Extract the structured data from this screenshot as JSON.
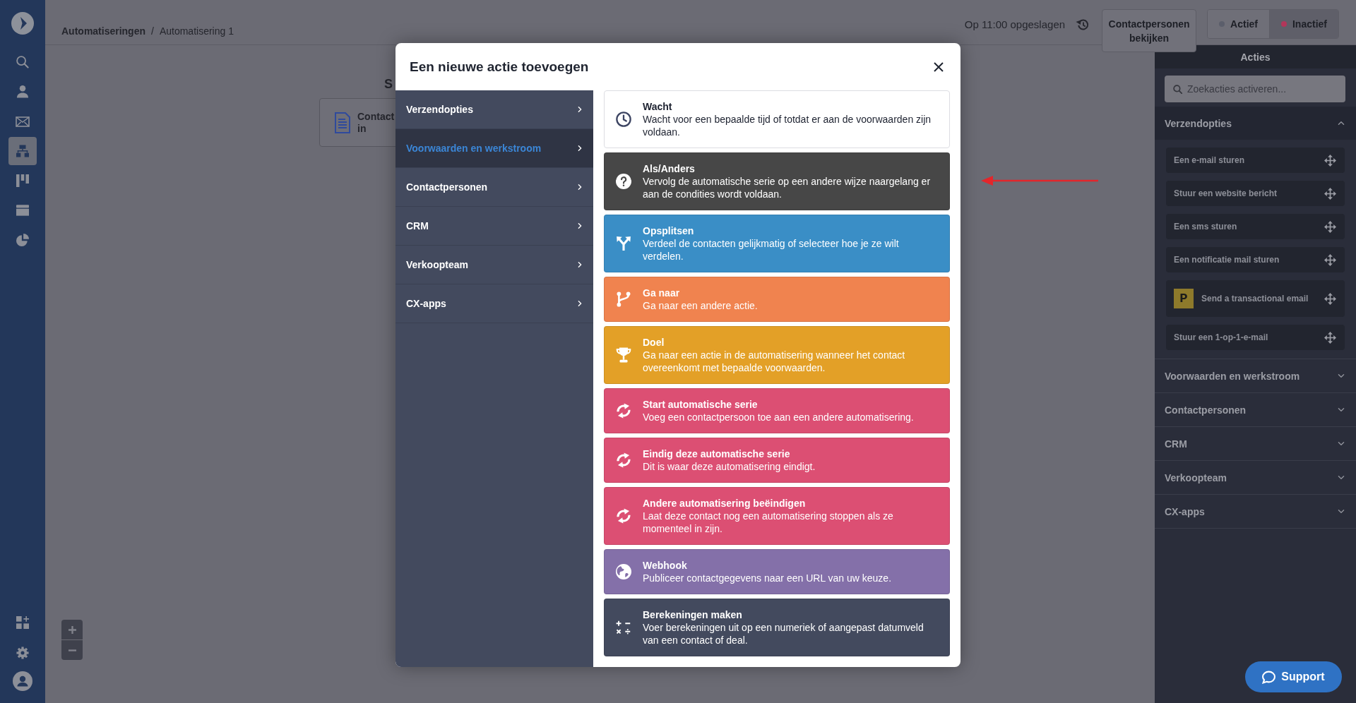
{
  "sidebar": {
    "items": [
      {
        "kind": "search",
        "selected": false
      },
      {
        "kind": "contacts",
        "selected": false
      },
      {
        "kind": "campaigns",
        "selected": false
      },
      {
        "kind": "automations",
        "selected": true
      },
      {
        "kind": "deals",
        "selected": false
      },
      {
        "kind": "pages",
        "selected": false
      },
      {
        "kind": "reports",
        "selected": false
      }
    ],
    "bottom_items": [
      {
        "kind": "apps",
        "selected": false
      },
      {
        "kind": "settings",
        "selected": false
      },
      {
        "kind": "account",
        "selected": false
      }
    ]
  },
  "breadcrumb": {
    "items": [
      "Automatiseringen",
      "Automatisering 1"
    ],
    "separator": "/"
  },
  "header": {
    "saved_status": "Op 11:00 opgeslagen",
    "contacts_button": "Contactpersonen bekijken",
    "status_toggle": [
      {
        "label": "Actief",
        "selected": false,
        "color": "#5b5e6b"
      },
      {
        "label": "Inactief",
        "selected": true,
        "color": "#b2375a"
      }
    ]
  },
  "canvas": {
    "heading": "S",
    "trigger_node": {
      "lines": [
        "Contact",
        "in"
      ]
    }
  },
  "modal": {
    "title": "Een nieuwe actie toevoegen",
    "categories": [
      {
        "label": "Verzendopties",
        "selected": false
      },
      {
        "label": "Voorwaarden en werkstroom",
        "selected": true
      },
      {
        "label": "Contactpersonen",
        "selected": false
      },
      {
        "label": "CRM",
        "selected": false
      },
      {
        "label": "Verkoopteam",
        "selected": false
      },
      {
        "label": "CX-apps",
        "selected": false
      }
    ],
    "actions": [
      {
        "kind": "wait",
        "color": "#ffffff",
        "title": "Wacht",
        "description": "Wacht voor een bepaalde tijd of totdat er aan de voorwaarden zijn voldaan."
      },
      {
        "kind": "condition",
        "color": "#474747",
        "title": "Als/Anders",
        "description": "Vervolg de automatische serie op een andere wijze naargelang er aan de condities wordt voldaan."
      },
      {
        "kind": "split",
        "color": "#3a8ec6",
        "title": "Opsplitsen",
        "description": "Verdeel de contacten gelijkmatig of selecteer hoe je ze wilt verdelen."
      },
      {
        "kind": "goto",
        "color": "#f0834f",
        "title": "Ga naar",
        "description": "Ga naar een andere actie."
      },
      {
        "kind": "goal",
        "color": "#e3a027",
        "title": "Doel",
        "description": "Ga naar een actie in de automatisering wanneer het contact overeenkomt met bepaalde voorwaarden."
      },
      {
        "kind": "start",
        "color": "#dc4f73",
        "title": "Start automatische serie",
        "description": "Voeg een contactpersoon toe aan een andere automatisering."
      },
      {
        "kind": "end",
        "color": "#dc4f73",
        "title": "Eindig deze automatische serie",
        "description": "Dit is waar deze automatisering eindigt."
      },
      {
        "kind": "stop",
        "color": "#dc4f73",
        "title": "Andere automatisering beëindigen",
        "description": "Laat deze contact nog een automatisering stoppen als ze momenteel in zijn."
      },
      {
        "kind": "webhook",
        "color": "#8470a9",
        "title": "Webhook",
        "description": "Publiceer contactgegevens naar een URL van uw keuze."
      },
      {
        "kind": "math",
        "color": "#434a5e",
        "title": "Berekeningen maken",
        "description": "Voer berekeningen uit op een numeriek of aangepast datumveld van een contact of deal."
      }
    ]
  },
  "actions_panel": {
    "title": "Acties",
    "search": {
      "placeholder": "Zoekacties activeren..."
    },
    "sections": [
      {
        "title": "Verzendopties",
        "expanded": true,
        "items": [
          {
            "kind": "action",
            "label": "Een e-mail sturen"
          },
          {
            "kind": "action",
            "label": "Stuur een website bericht"
          },
          {
            "kind": "action",
            "label": "Een sms sturen"
          },
          {
            "kind": "action",
            "label": "Een notificatie mail sturen"
          },
          {
            "kind": "app",
            "badge": "P",
            "label": "Send a transactional email"
          },
          {
            "kind": "action",
            "label": "Stuur een 1-op-1-e-mail"
          }
        ]
      },
      {
        "title": "Voorwaarden en werkstroom",
        "expanded": false
      },
      {
        "title": "Contactpersonen",
        "expanded": false
      },
      {
        "title": "CRM",
        "expanded": false
      },
      {
        "title": "Verkoopteam",
        "expanded": false
      },
      {
        "title": "CX-apps",
        "expanded": false
      }
    ]
  },
  "support_button": {
    "label": "Support"
  }
}
